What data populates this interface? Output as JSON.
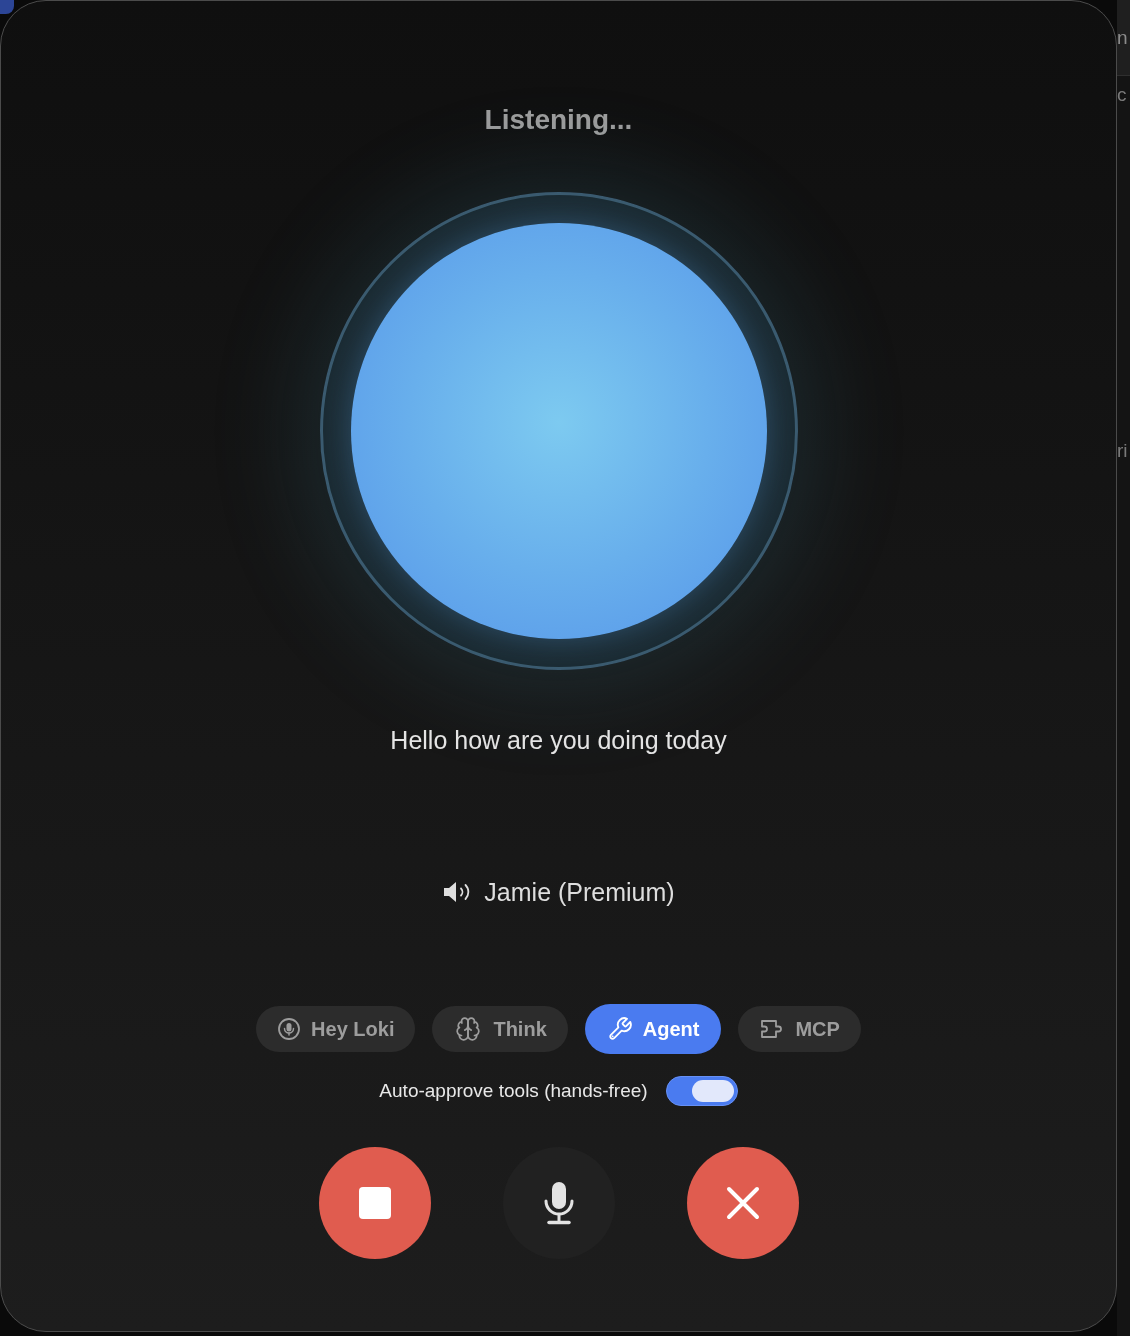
{
  "status": "Listening...",
  "transcript": "Hello how are you doing today",
  "voice": {
    "label": "Jamie (Premium)"
  },
  "modes": [
    {
      "kind": "wake",
      "label": "Hey Loki",
      "selected": false
    },
    {
      "kind": "think",
      "label": "Think",
      "selected": false
    },
    {
      "kind": "agent",
      "label": "Agent",
      "selected": true
    },
    {
      "kind": "mcp",
      "label": "MCP",
      "selected": false
    }
  ],
  "auto_approve": {
    "label": "Auto-approve tools (hands-free)",
    "on": true
  },
  "controls": [
    {
      "kind": "stop"
    },
    {
      "kind": "mic"
    },
    {
      "kind": "close"
    }
  ],
  "background_window": {
    "title_fragment": "n",
    "texts": [
      "c",
      "ri"
    ]
  }
}
